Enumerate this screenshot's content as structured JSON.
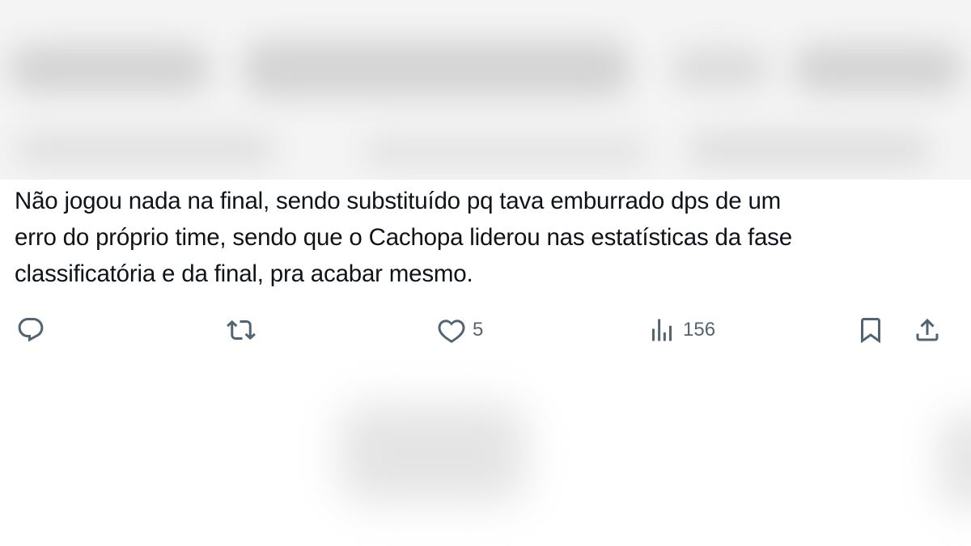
{
  "tweet": {
    "text_lines": [
      "Não jogou nada na final, sendo substituído pq tava emburrado dps de um",
      "erro do próprio time, sendo que o Cachopa liderou nas estatísticas da fase",
      "classificatória e da final, pra acabar mesmo."
    ]
  },
  "actions": {
    "reply_icon": "reply-bubble-icon",
    "retweet_icon": "retweet-icon",
    "like_icon": "heart-icon",
    "like_count": "5",
    "views_icon": "bar-chart-icon",
    "views_count": "156",
    "bookmark_icon": "bookmark-icon",
    "share_icon": "share-upload-icon"
  },
  "colors": {
    "text": "#0f1419",
    "icon": "#536471",
    "background": "#ffffff"
  }
}
